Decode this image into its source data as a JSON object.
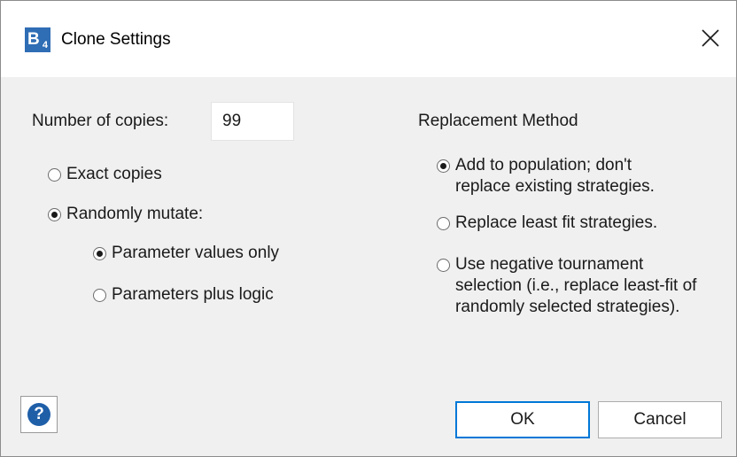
{
  "window": {
    "title": "Clone Settings",
    "logo_main": "B",
    "logo_sub": "4"
  },
  "copies": {
    "label": "Number of copies:",
    "value": "99"
  },
  "mode": {
    "exact": {
      "label": "Exact copies",
      "selected": false
    },
    "mutate": {
      "label": "Randomly mutate:",
      "selected": true
    },
    "mutate_options": {
      "param_values": {
        "label": "Parameter values only",
        "selected": true
      },
      "param_logic": {
        "label": "Parameters plus logic",
        "selected": false
      }
    }
  },
  "replacement": {
    "heading": "Replacement Method",
    "add": {
      "line1": "Add to population; don't",
      "line2": "replace existing strategies.",
      "selected": true
    },
    "least_fit": {
      "label": "Replace least fit strategies.",
      "selected": false
    },
    "tournament": {
      "line1": "Use negative tournament",
      "line2": "selection (i.e., replace least-fit of",
      "line3": "randomly selected strategies).",
      "selected": false
    }
  },
  "buttons": {
    "help_glyph": "?",
    "ok": "OK",
    "cancel": "Cancel"
  },
  "colors": {
    "accent": "#0078d7",
    "logo": "#2f6db5",
    "help": "#1f5fa8"
  }
}
